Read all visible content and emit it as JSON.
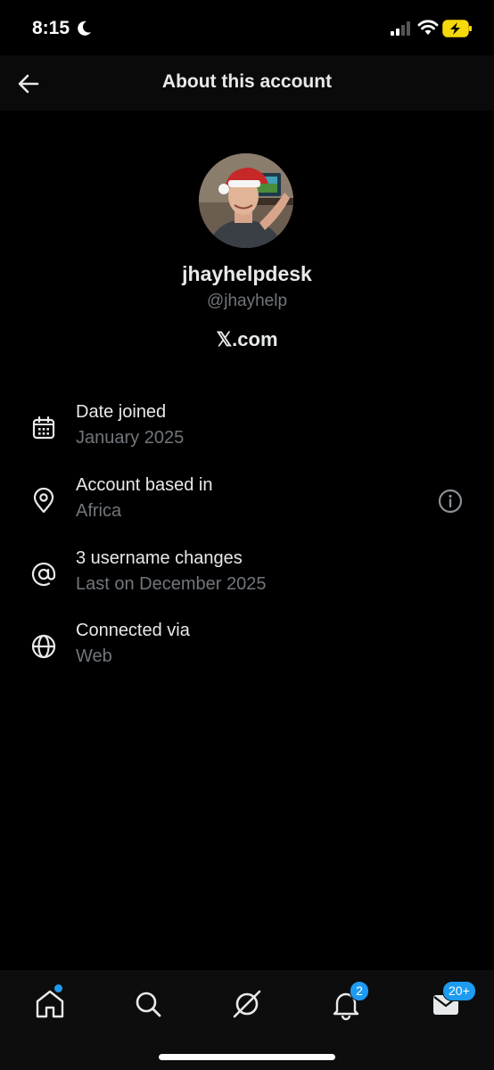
{
  "status_bar": {
    "time": "8:15"
  },
  "header": {
    "title": "About this account"
  },
  "profile": {
    "display_name": "jhayhelpdesk",
    "handle": "@jhayhelp",
    "platform": "𝕏.com"
  },
  "info": [
    {
      "label": "Date joined",
      "value": "January 2025",
      "icon": "calendar-icon"
    },
    {
      "label": "Account based in",
      "value": "Africa",
      "icon": "location-pin-icon"
    },
    {
      "label": "3 username changes",
      "value": "Last on December 2025",
      "icon": "at-sign-icon"
    },
    {
      "label": "Connected via",
      "value": "Web",
      "icon": "globe-icon"
    }
  ],
  "tab_bar": {
    "notifications_badge": "2",
    "messages_badge": "20+"
  },
  "colors": {
    "accent": "#1d9bf0",
    "background": "#000000",
    "text_primary": "#e7e9ea",
    "text_secondary": "#71767b",
    "battery": "#f5d90a"
  }
}
